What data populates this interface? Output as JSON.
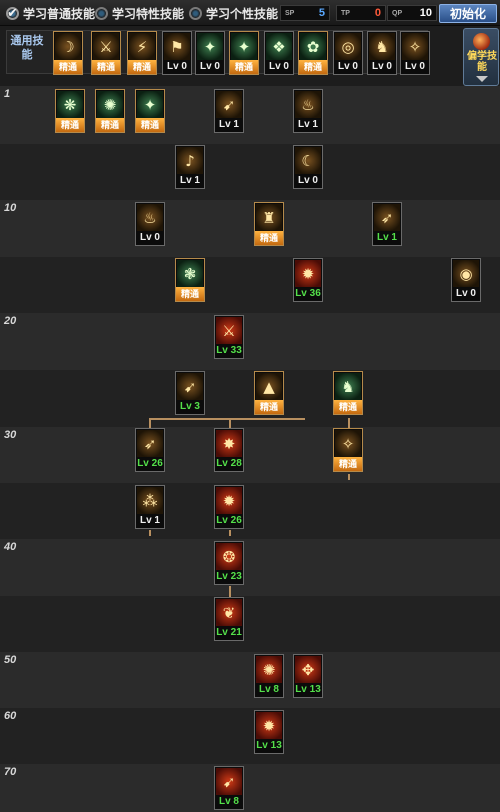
{
  "topbar": {
    "tabs": [
      {
        "label": "学习普通技能",
        "selected": true
      },
      {
        "label": "学习特性技能",
        "selected": false
      },
      {
        "label": "学习个性技能",
        "selected": false
      }
    ],
    "sp": [
      {
        "label": "SP",
        "value": "5",
        "color": "#5aa9ff"
      },
      {
        "label": "TP",
        "value": "0",
        "color": "#ff5a3a"
      },
      {
        "label": "QP",
        "value": "10",
        "color": "#ffffff"
      }
    ],
    "init_label": "初始化"
  },
  "common": {
    "label": "通用技能",
    "skills": [
      {
        "icon": "☽",
        "tone": "gold",
        "label": "精通",
        "kind": "master"
      },
      {
        "icon": "⚔",
        "tone": "gold",
        "label": "精通",
        "kind": "master"
      },
      {
        "icon": "⚡",
        "tone": "gold",
        "label": "精通",
        "kind": "master"
      },
      {
        "icon": "⚑",
        "tone": "gold",
        "label": "Lv 0",
        "kind": "plain"
      },
      {
        "icon": "✦",
        "tone": "green",
        "label": "Lv 0",
        "kind": "plain"
      },
      {
        "icon": "✦",
        "tone": "green",
        "label": "精通",
        "kind": "master"
      },
      {
        "icon": "❖",
        "tone": "green",
        "label": "Lv 0",
        "kind": "plain"
      },
      {
        "icon": "✿",
        "tone": "green",
        "label": "精通",
        "kind": "master"
      },
      {
        "icon": "◎",
        "tone": "gold",
        "label": "Lv 0",
        "kind": "plain"
      },
      {
        "icon": "♞",
        "tone": "gold",
        "label": "Lv 0",
        "kind": "plain"
      },
      {
        "icon": "✧",
        "tone": "gold",
        "label": "Lv 0",
        "kind": "plain"
      }
    ]
  },
  "learn_panel": {
    "label": "偏学技能"
  },
  "levels": [
    "1",
    "",
    "10",
    "",
    "20",
    "",
    "30",
    "",
    "40",
    "",
    "50",
    "60",
    "70"
  ],
  "tree": [
    {
      "icon": "❋",
      "tone": "green",
      "label": "精通",
      "kind": "master"
    },
    {
      "icon": "✺",
      "tone": "green",
      "label": "精通",
      "kind": "master"
    },
    {
      "icon": "✦",
      "tone": "green",
      "label": "精通",
      "kind": "master"
    },
    {
      "icon": "➹",
      "tone": "gold",
      "label": "Lv 1",
      "kind": "plain"
    },
    {
      "icon": "♨",
      "tone": "gold",
      "label": "Lv 1",
      "kind": "plain"
    },
    {
      "icon": "♪",
      "tone": "gold",
      "label": "Lv 1",
      "kind": "plain"
    },
    {
      "icon": "☾",
      "tone": "gold",
      "label": "Lv 0",
      "kind": "plain"
    },
    {
      "icon": "♨",
      "tone": "gold",
      "label": "Lv 0",
      "kind": "plain"
    },
    {
      "icon": "♜",
      "tone": "gold",
      "label": "精通",
      "kind": "master"
    },
    {
      "icon": "➶",
      "tone": "gold",
      "label": "Lv 1",
      "kind": "green"
    },
    {
      "icon": "❃",
      "tone": "green",
      "label": "精通",
      "kind": "master"
    },
    {
      "icon": "✹",
      "tone": "red",
      "label": "Lv 36",
      "kind": "green"
    },
    {
      "icon": "◉",
      "tone": "gold",
      "label": "Lv 0",
      "kind": "plain"
    },
    {
      "icon": "⚔",
      "tone": "red",
      "label": "Lv 33",
      "kind": "green"
    },
    {
      "icon": "➹",
      "tone": "gold",
      "label": "Lv 3",
      "kind": "green"
    },
    {
      "icon": "▲",
      "tone": "gold",
      "label": "精通",
      "kind": "master"
    },
    {
      "icon": "♞",
      "tone": "green",
      "label": "精通",
      "kind": "master"
    },
    {
      "icon": "➶",
      "tone": "gold",
      "label": "Lv 26",
      "kind": "green"
    },
    {
      "icon": "✸",
      "tone": "red",
      "label": "Lv 28",
      "kind": "green"
    },
    {
      "icon": "✧",
      "tone": "gold",
      "label": "精通",
      "kind": "master"
    },
    {
      "icon": "⁂",
      "tone": "gold",
      "label": "Lv 1",
      "kind": "plain"
    },
    {
      "icon": "✹",
      "tone": "red",
      "label": "Lv 26",
      "kind": "green"
    },
    {
      "icon": "❂",
      "tone": "red",
      "label": "Lv 23",
      "kind": "green"
    },
    {
      "icon": "❦",
      "tone": "red",
      "label": "Lv 21",
      "kind": "green"
    },
    {
      "icon": "✺",
      "tone": "red",
      "label": "Lv 8",
      "kind": "green"
    },
    {
      "icon": "✥",
      "tone": "red",
      "label": "Lv 13",
      "kind": "green"
    },
    {
      "icon": "✹",
      "tone": "red",
      "label": "Lv 13",
      "kind": "green"
    },
    {
      "icon": "➹",
      "tone": "red",
      "label": "Lv 8",
      "kind": "green"
    }
  ]
}
